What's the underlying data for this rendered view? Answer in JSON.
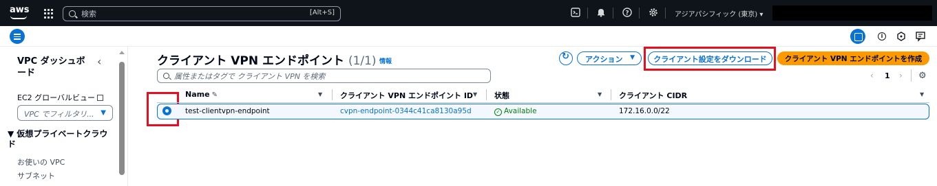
{
  "topnav": {
    "logo_text": "aws",
    "search_placeholder": "検索",
    "search_shortcut": "[Alt+S]",
    "region": "アジアパシフィック (東京) ▾",
    "icons": [
      "cloudshell-icon",
      "bell-icon",
      "help-icon",
      "gear-icon"
    ]
  },
  "sidebar": {
    "title": "VPC ダッシュボード",
    "close_glyph": "‹",
    "ec2_link": "EC2 グローバルビュー",
    "filter_placeholder": "VPC でフィルタリ...",
    "section_title": "▼ 仮想プライベートクラウド",
    "items": [
      "お使いの VPC",
      "サブネット"
    ]
  },
  "main": {
    "title": "クライアント VPN エンドポイント",
    "count": "(1/1)",
    "info": "情報",
    "actions_label": "アクション",
    "download_label": "クライアント設定をダウンロード",
    "create_label": "クライアント VPN エンドポイントを作成",
    "filter_placeholder": "属性またはタグで クライアント VPN を検索",
    "pager": {
      "prev": "‹",
      "page": "1",
      "next": "›"
    }
  },
  "table": {
    "columns": [
      "Name",
      "クライアント VPN エンドポイント ID",
      "状態",
      "クライアント CIDR"
    ],
    "rows": [
      {
        "name": "test-clientvpn-endpoint",
        "endpoint_id": "cvpn-endpoint-0344c41ca8130a95d",
        "status": "Available",
        "cidr": "172.16.0.0/22",
        "selected": true
      }
    ]
  },
  "colors": {
    "nav_bg": "#0f141a",
    "accent": "#0972d3",
    "primary_button": "#ff9900",
    "success": "#037f0c",
    "annotation_red": "#e4101f"
  }
}
